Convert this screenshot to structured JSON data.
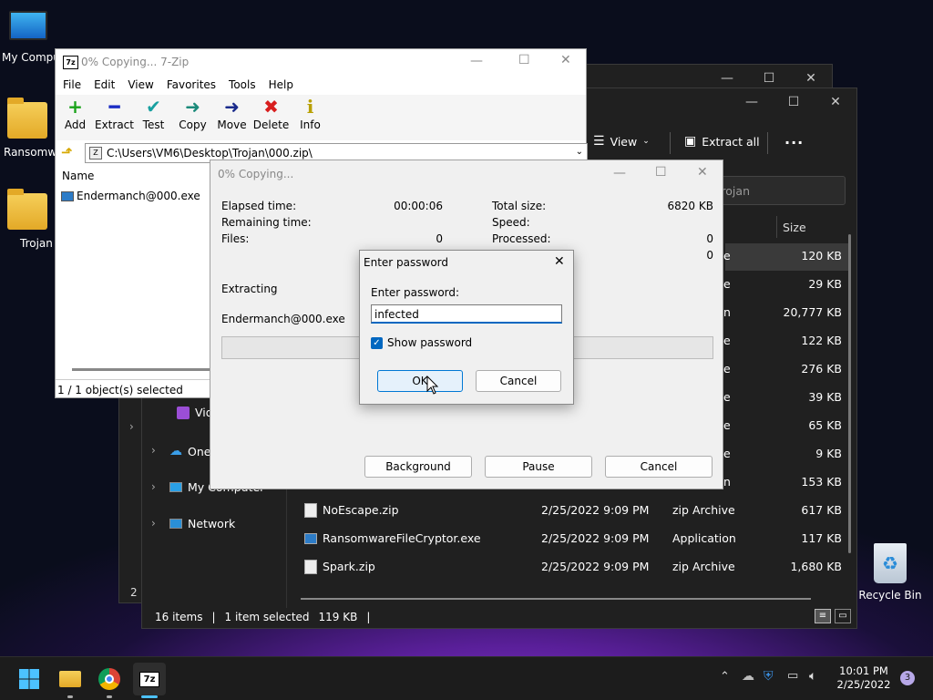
{
  "desktop": {
    "icons": [
      {
        "label": "My Computer"
      },
      {
        "label": "Ransomware"
      },
      {
        "label": "Trojan"
      },
      {
        "label": "Recycle Bin"
      }
    ]
  },
  "explorer": {
    "toolbar": {
      "view_label": "View",
      "extract_all_label": "Extract all",
      "more_label": "..."
    },
    "search_placeholder": "Search Trojan",
    "size_header": "Size",
    "nav": [
      {
        "label": "Videos"
      },
      {
        "label": "OneDrive"
      },
      {
        "label": "My Computer"
      },
      {
        "label": "Network"
      }
    ],
    "partial_rows": [
      {
        "type_tail": "e",
        "size": "120 KB"
      },
      {
        "type_tail": "e",
        "size": "29 KB"
      },
      {
        "type_tail": "n",
        "size": "20,777 KB"
      },
      {
        "type_tail": "e",
        "size": "122 KB"
      },
      {
        "type_tail": "e",
        "size": "276 KB"
      },
      {
        "type_tail": "e",
        "size": "39 KB"
      },
      {
        "type_tail": "e",
        "size": "65 KB"
      },
      {
        "type_tail": "e",
        "size": "9 KB"
      },
      {
        "type_tail": "n",
        "size": "153 KB"
      }
    ],
    "rows": [
      {
        "name": "NoEscape.zip",
        "date": "2/25/2022 9:09 PM",
        "type": "zip Archive",
        "size": "617 KB"
      },
      {
        "name": "RansomwareFileCryptor.exe",
        "date": "2/25/2022 9:09 PM",
        "type": "Application",
        "size": "117 KB"
      },
      {
        "name": "Spark.zip",
        "date": "2/25/2022 9:09 PM",
        "type": "zip Archive",
        "size": "1,680 KB"
      }
    ],
    "status": {
      "items": "16 items",
      "selected": "1 item selected",
      "size": "119 KB"
    },
    "back_window_status": "2 i"
  },
  "sevenzip": {
    "title": "0% Copying... 7-Zip",
    "menu": [
      "File",
      "Edit",
      "View",
      "Favorites",
      "Tools",
      "Help"
    ],
    "tools": [
      {
        "label": "Add",
        "glyph": "+",
        "color": "#1aa31a"
      },
      {
        "label": "Extract",
        "glyph": "━",
        "color": "#1a2cc4"
      },
      {
        "label": "Test",
        "glyph": "✔",
        "color": "#18a0a0"
      },
      {
        "label": "Copy",
        "glyph": "➜",
        "color": "#1b8a7a"
      },
      {
        "label": "Move",
        "glyph": "➜",
        "color": "#1a2b8c"
      },
      {
        "label": "Delete",
        "glyph": "✖",
        "color": "#d81e1e"
      },
      {
        "label": "Info",
        "glyph": "i",
        "color": "#b8a000"
      }
    ],
    "path": "C:\\Users\\VM6\\Desktop\\Trojan\\000.zip\\",
    "column_name": "Name",
    "file": "Endermanch@000.exe",
    "status": "1 / 1 object(s) selected"
  },
  "copy_dialog": {
    "title": "0% Copying...",
    "elapsed_label": "Elapsed time:",
    "elapsed_value": "00:00:06",
    "remaining_label": "Remaining time:",
    "files_label": "Files:",
    "files_value": "0",
    "total_label": "Total size:",
    "total_value": "6820 KB",
    "speed_label": "Speed:",
    "processed_label": "Processed:",
    "processed_value": "0",
    "extra_value": "0",
    "action": "Extracting",
    "current_file": "Endermanch@000.exe",
    "progress": 0,
    "buttons": {
      "background": "Background",
      "pause": "Pause",
      "cancel": "Cancel"
    }
  },
  "password_dialog": {
    "title": "Enter password",
    "prompt": "Enter password:",
    "value": "infected",
    "show_password_label": "Show password",
    "show_password_checked": true,
    "ok": "OK",
    "cancel": "Cancel"
  },
  "taskbar": {
    "time": "10:01 PM",
    "date": "2/25/2022",
    "badge": "3"
  }
}
